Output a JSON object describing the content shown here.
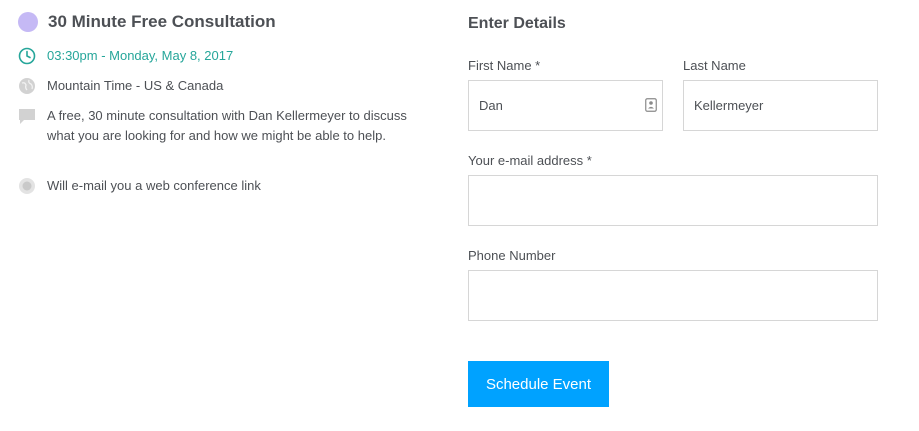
{
  "event": {
    "title": "30 Minute Free Consultation",
    "color": "#c5b9f5",
    "time": "03:30pm - Monday, May 8, 2017",
    "timezone": "Mountain Time - US & Canada",
    "description": "A free, 30 minute consultation with Dan Kellermeyer to discuss what you are looking for and how we might be able to help.",
    "conference_note": "Will e-mail you a web conference link"
  },
  "form": {
    "title": "Enter Details",
    "first_name": {
      "label": "First Name *",
      "value": "Dan"
    },
    "last_name": {
      "label": "Last Name",
      "value": "Kellermeyer"
    },
    "email": {
      "label": "Your e-mail address *",
      "value": ""
    },
    "phone": {
      "label": "Phone Number",
      "value": ""
    },
    "submit_label": "Schedule Event"
  },
  "colors": {
    "accent": "#00a2ff",
    "time": "#26a69a",
    "icon": "#c9c9c9"
  }
}
